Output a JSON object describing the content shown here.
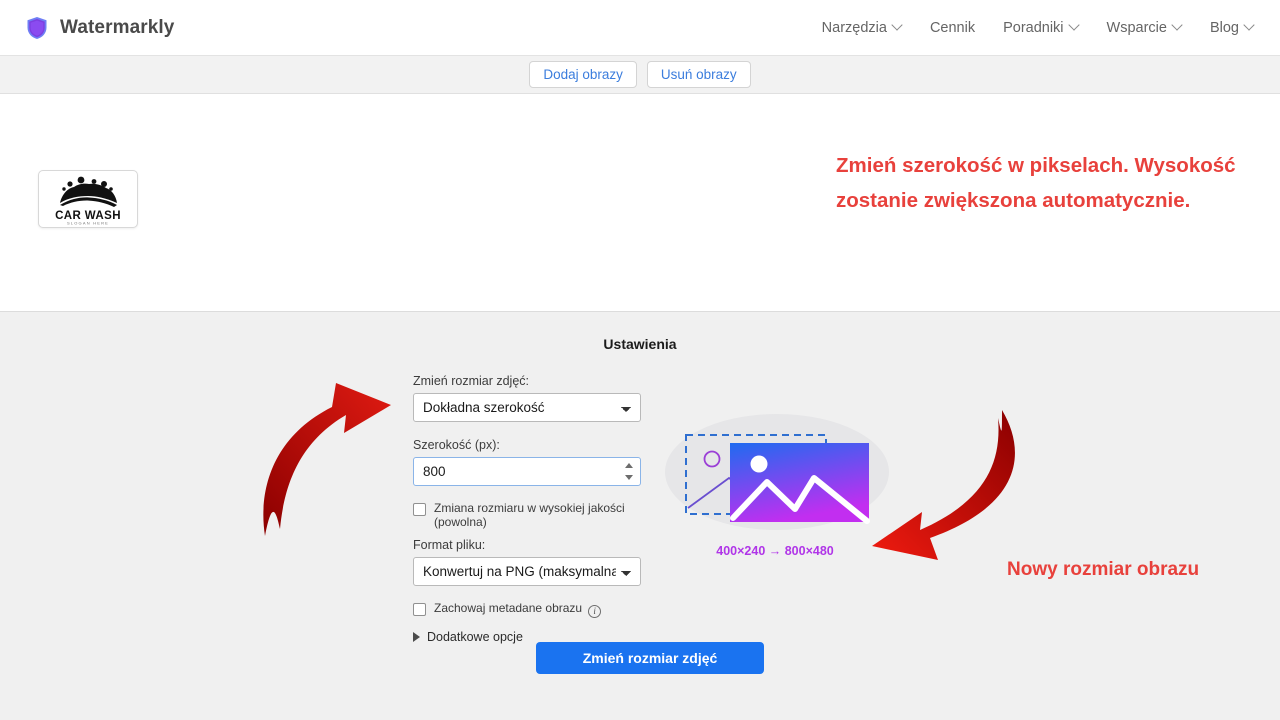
{
  "header": {
    "brand": "Watermarkly",
    "logo_icon": "shield-icon",
    "nav": [
      {
        "label": "Narzędzia",
        "has_caret": true
      },
      {
        "label": "Cennik",
        "has_caret": false
      },
      {
        "label": "Poradniki",
        "has_caret": true
      },
      {
        "label": "Wsparcie",
        "has_caret": true
      },
      {
        "label": "Blog",
        "has_caret": true
      }
    ]
  },
  "toolbar": {
    "add_images": "Dodaj obrazy",
    "remove_images": "Usuń obrazy"
  },
  "image_area": {
    "thumbnail_alt": "CAR WASH",
    "thumbnail_title": "CAR WASH",
    "thumbnail_slogan": "SLOGAN HERE",
    "annotation": "Zmień szerokość w pikselach. Wysokość zostanie zwiększona automatycznie."
  },
  "settings": {
    "title": "Ustawienia",
    "resize_mode_label": "Zmień rozmiar zdjęć:",
    "resize_mode_value": "Dokładna szerokość",
    "width_label": "Szerokość (px):",
    "width_value": "800",
    "high_quality_label": "Zmiana rozmiaru w wysokiej jakości (powolna)",
    "high_quality_checked": false,
    "file_format_label": "Format pliku:",
    "file_format_value": "Konwertuj na PNG (maksymalna jak",
    "keep_metadata_label": "Zachowaj metadane obrazu",
    "keep_metadata_checked": false,
    "info_icon": "info-icon",
    "more_options_label": "Dodatkowe opcje",
    "more_options_expanded": false,
    "submit_label": "Zmień rozmiar zdjęć"
  },
  "preview": {
    "caption": "400×240 → 800×480",
    "source_size": "400×240",
    "target_size": "800×480",
    "annotation": "Nowy rozmiar obrazu"
  },
  "colors": {
    "accent_blue": "#1a73f0",
    "link_blue": "#3b7ddd",
    "annotation_red": "#e8413c",
    "arrow_red": "#b81010",
    "caption_purple": "#b035e8",
    "image_gradient_from": "#1f6bf0",
    "image_gradient_to": "#c22ef0"
  }
}
